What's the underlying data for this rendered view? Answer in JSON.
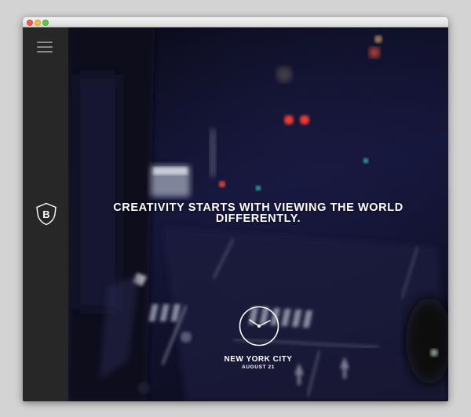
{
  "hero": {
    "headline_line1": "CREATIVITY STARTS WITH VIEWING THE WORLD",
    "headline_line2": "DIFFERENTLY."
  },
  "location": {
    "city": "NEW YORK CITY",
    "date": "AUGUST 21"
  },
  "logo": {
    "letter": "B"
  },
  "icons": {
    "menu": "hamburger-menu-icon",
    "logo": "shield-b-logo",
    "clock": "analog-clock-icon"
  },
  "colors": {
    "sidebar": "#272727",
    "text": "#ffffff",
    "hero_tint": "#15163a"
  }
}
